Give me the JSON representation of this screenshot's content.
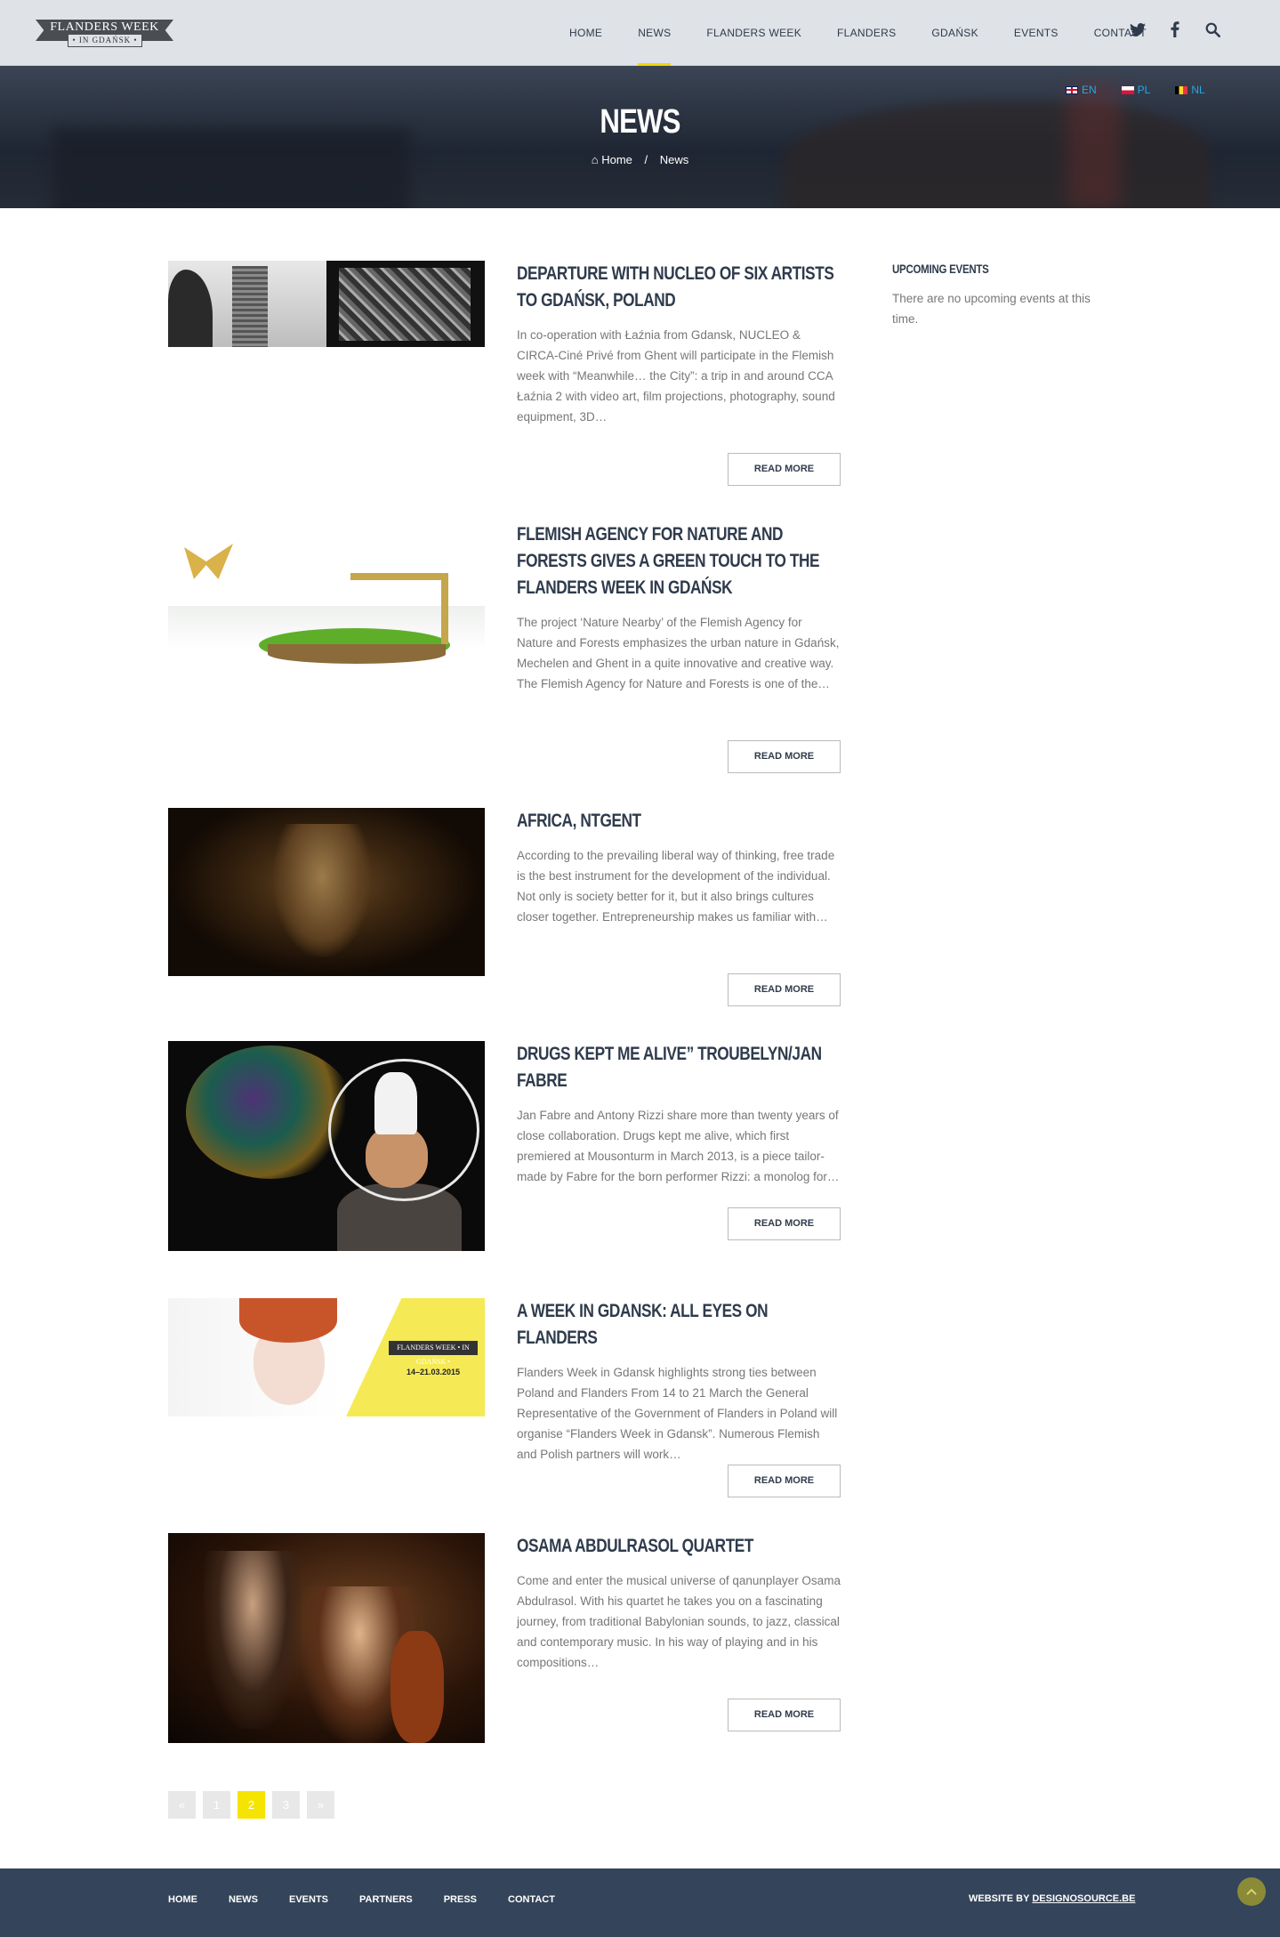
{
  "header": {
    "logo": {
      "line1": "FLANDERS WEEK",
      "line2": "• IN GDAŃSK •"
    },
    "nav": [
      "HOME",
      "NEWS",
      "FLANDERS WEEK",
      "FLANDERS",
      "GDAŃSK",
      "EVENTS",
      "CONTACT"
    ],
    "active_nav": "NEWS",
    "social": {
      "twitter": "twitter-icon",
      "facebook": "facebook-icon",
      "search": "search-icon"
    }
  },
  "hero": {
    "title": "NEWS",
    "breadcrumb": {
      "home": "Home",
      "separator": "/",
      "current": "News"
    },
    "languages": [
      {
        "code": "EN",
        "flag": "uk-flag-icon"
      },
      {
        "code": "PL",
        "flag": "poland-flag-icon"
      },
      {
        "code": "NL",
        "flag": "belgium-flag-icon"
      }
    ]
  },
  "posts": [
    {
      "title": "DEPARTURE WITH NUCLEO OF SIX ARTISTS TO GDAŃSK, POLAND",
      "excerpt": "In co-operation with Łaźnia from Gdansk, NUCLEO & CIRCA-Ciné Privé from Ghent will participate in the Flemish week with “Meanwhile… the City”: a trip in and around CCA Łaźnia 2 with video art, film projections, photography, sound equipment, 3D…",
      "read_more": "READ MORE"
    },
    {
      "title": "FLEMISH AGENCY FOR NATURE AND FORESTS GIVES A GREEN TOUCH TO THE FLANDERS WEEK IN GDAŃSK",
      "excerpt": "The project ‘Nature Nearby’ of the Flemish Agency for Nature and Forests emphasizes the urban nature in Gdańsk, Mechelen and Ghent in a quite innovative and creative way. The Flemish Agency for Nature and Forests is one of the…",
      "read_more": "READ MORE"
    },
    {
      "title": "AFRICA, NTGENT",
      "excerpt": "According to the prevailing liberal way of thinking, free trade is the best instrument for the development of the individual. Not only is society better for it, but it also brings cultures closer together. Entrepreneurship makes us familiar with…",
      "read_more": "READ MORE"
    },
    {
      "title": "DRUGS KEPT ME ALIVE” TROUBELYN/JAN FABRE",
      "excerpt": "Jan Fabre and Antony Rizzi share more than twenty years of close collaboration. Drugs kept me alive, which first premiered at Mousonturm in March 2013, is a piece tailor-made by Fabre for the born performer Rizzi: a monolog for…",
      "read_more": "READ MORE"
    },
    {
      "title": "A WEEK IN GDANSK: ALL EYES ON FLANDERS",
      "excerpt": "Flanders Week in Gdansk highlights strong ties between Poland and Flanders From 14 to 21 March the General Representative of the Government of Flanders in Poland will organise “Flanders Week in Gdansk”. Numerous Flemish and Polish partners will work…",
      "read_more": "READ MORE",
      "image_text": {
        "label": "FLANDERS WEEK • IN GDAŃSK •",
        "dates": "14–21.03.2015"
      }
    },
    {
      "title": "OSAMA ABDULRASOL QUARTET",
      "excerpt": "Come and enter the musical universe of qanunplayer Osama Abdulrasol. With his quartet he takes you on a fascinating journey, from traditional Babylonian sounds, to jazz, classical and contemporary music. In his way of playing and in his compositions…",
      "read_more": "READ MORE"
    }
  ],
  "pagination": {
    "prev": "«",
    "pages": [
      "1",
      "2",
      "3"
    ],
    "current": "2",
    "next": "»"
  },
  "sidebar": {
    "title": "UPCOMING EVENTS",
    "text": "There are no upcoming events at this time."
  },
  "footer": {
    "nav": [
      "HOME",
      "NEWS",
      "EVENTS",
      "PARTNERS",
      "PRESS",
      "CONTACT"
    ],
    "credit_prefix": "WEBSITE BY",
    "credit_link": "DESIGNOSOURCE.BE",
    "to_top": "arrow-up-icon"
  },
  "colors": {
    "accent_yellow": "#f0d800",
    "heading": "#2f3b4c",
    "footer_bg": "#34445a",
    "link_blue": "#2aa6e0"
  }
}
